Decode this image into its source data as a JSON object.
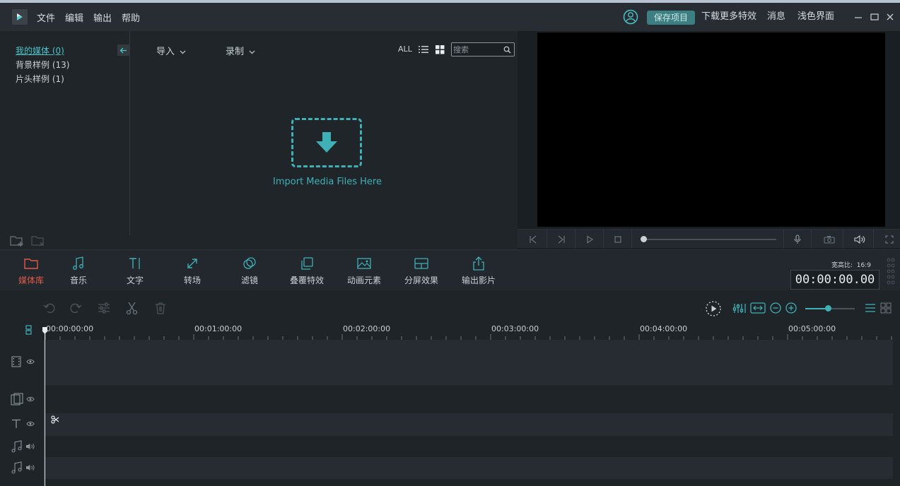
{
  "title_bar": {
    "menu": [
      "文件",
      "编辑",
      "输出",
      "帮助"
    ],
    "save_project": "保存项目",
    "download_effects": "下载更多特效",
    "messages": "消息",
    "light_ui": "浅色界面"
  },
  "media_library": {
    "items": [
      {
        "label": "我的媒体 (0)",
        "active": true
      },
      {
        "label": "背景样例 (13)",
        "active": false
      },
      {
        "label": "片头样例 (1)",
        "active": false
      }
    ],
    "import_label": "导入",
    "record_label": "录制",
    "view_all": "ALL",
    "search_placeholder": "搜索",
    "import_hint": "Import Media Files Here"
  },
  "toolbar": {
    "tools": [
      {
        "label": "媒体库",
        "icon": "folder-icon",
        "active": true
      },
      {
        "label": "音乐",
        "icon": "music-note-icon",
        "active": false
      },
      {
        "label": "文字",
        "icon": "text-icon",
        "active": false
      },
      {
        "label": "转场",
        "icon": "transition-icon",
        "active": false
      },
      {
        "label": "滤镜",
        "icon": "filter-icon",
        "active": false
      },
      {
        "label": "叠覆特效",
        "icon": "overlay-icon",
        "active": false
      },
      {
        "label": "动画元素",
        "icon": "image-icon",
        "active": false
      },
      {
        "label": "分屏效果",
        "icon": "split-screen-icon",
        "active": false
      },
      {
        "label": "输出影片",
        "icon": "export-icon",
        "active": false
      }
    ],
    "aspect_ratio_label": "宽高比:",
    "aspect_ratio_value": "16:9",
    "timecode": "00:00:00.00"
  },
  "timeline": {
    "ruler_labels": [
      "00:00:00:00",
      "00:01:00:00",
      "00:02:00:00",
      "00:03:00:00",
      "00:04:00:00",
      "00:05:00:00"
    ],
    "zoom_level": 0.45
  },
  "colors": {
    "accent": "#3fb0b5",
    "active_tool": "#e05a4a",
    "background": "#1e2428"
  }
}
